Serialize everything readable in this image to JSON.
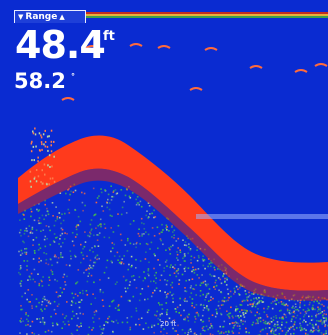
{
  "window": {
    "title": ""
  },
  "range_tab": {
    "label": "Range",
    "left_arrow": "▼",
    "right_arrow": "▲"
  },
  "depth": {
    "value": "48.4",
    "unit": "ft"
  },
  "secondary": {
    "value": "58.2",
    "unit": "°"
  },
  "bottom_scale": {
    "label": "20 ft"
  },
  "colors": {
    "water": "#0a2bd1",
    "bottom_return": "#ff3a1c",
    "weak_return": "#43c04a",
    "clutter": "#b8d6a6",
    "text": "#ffffff"
  },
  "icons": {
    "fish_marker": "fish-arch-icon"
  }
}
